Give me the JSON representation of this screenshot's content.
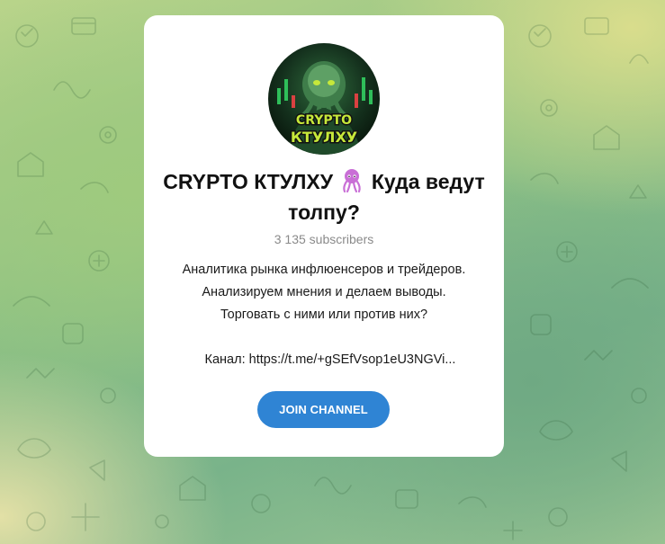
{
  "channel": {
    "title_part1": "CRYPTO КТУЛХУ",
    "title_emoji": "octopus-emoji",
    "title_part2": "Куда ведут толпу?",
    "subscribers": "3 135 subscribers",
    "avatar_text_top": "CRYPTO",
    "avatar_text_bottom": "КТУЛХУ",
    "description_lines": [
      "Аналитика рынка инфлюенсеров и трейдеров.",
      "Анализируем мнения и делаем выводы.",
      "Торговать с ними или против них?"
    ],
    "description_link": "Канал: https://t.me/+gSEfVsop1eU3NGVi..."
  },
  "actions": {
    "join_label": "JOIN CHANNEL"
  },
  "colors": {
    "button": "#2f84d4",
    "avatar_accent": "#c6e83a",
    "emoji": "#c96fd6"
  }
}
